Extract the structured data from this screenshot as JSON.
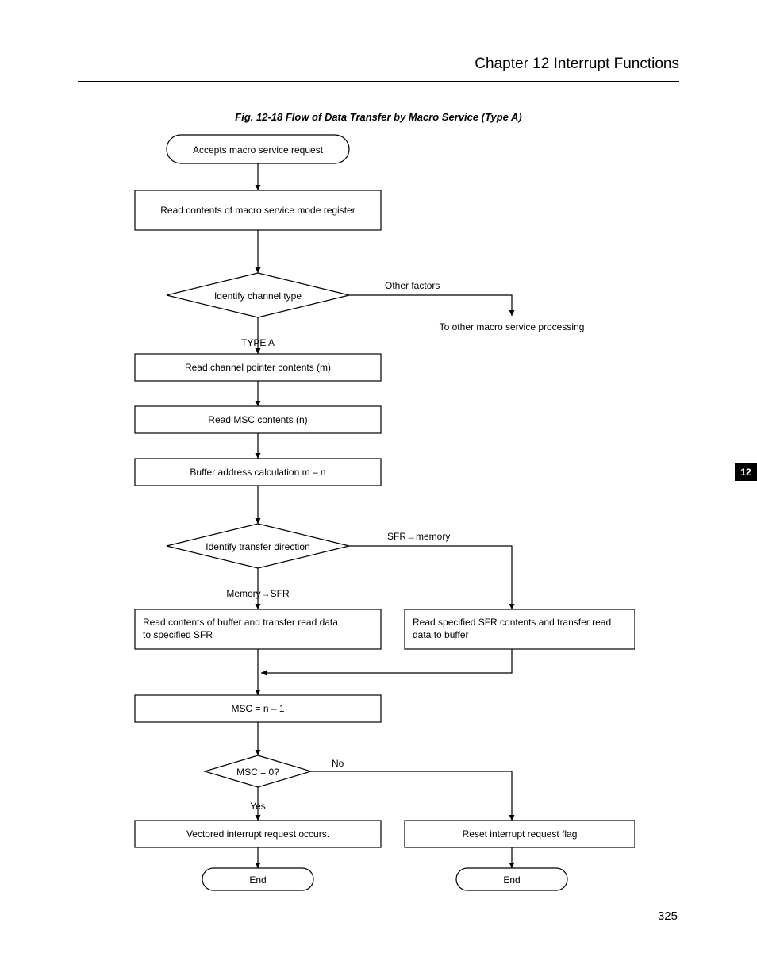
{
  "header": {
    "chapter_title": "Chapter 12   Interrupt Functions",
    "tab_number": "12",
    "page_number": "325"
  },
  "figure": {
    "title": "Fig. 12-18  Flow of Data Transfer by Macro Service (Type A)"
  },
  "nodes": {
    "start": "Accepts macro service request",
    "read_mode_reg": "Read contents of macro service mode register",
    "identify_channel": "Identify channel type",
    "branch_other": "Other factors",
    "to_other_proc": "To other macro service processing",
    "type_a": "TYPE A",
    "read_channel_ptr": "Read channel pointer contents (m)",
    "read_msc": "Read MSC contents (n)",
    "buffer_calc": "Buffer address calculation m – n",
    "identify_dir": "Identify transfer direction",
    "sfr_to_mem": "SFR→memory",
    "mem_to_sfr": "Memory→SFR",
    "left_action_l1": "Read contents of buffer and transfer read data",
    "left_action_l2": "to specified SFR",
    "right_action_l1": "Read specified SFR contents and transfer read",
    "right_action_l2": "data to buffer",
    "msc_decr": "MSC = n – 1",
    "msc_zero": "MSC = 0?",
    "no": "No",
    "yes": "Yes",
    "vectored_int": "Vectored interrupt request occurs.",
    "reset_flag": "Reset interrupt request flag",
    "end": "End",
    "end2": "End"
  }
}
